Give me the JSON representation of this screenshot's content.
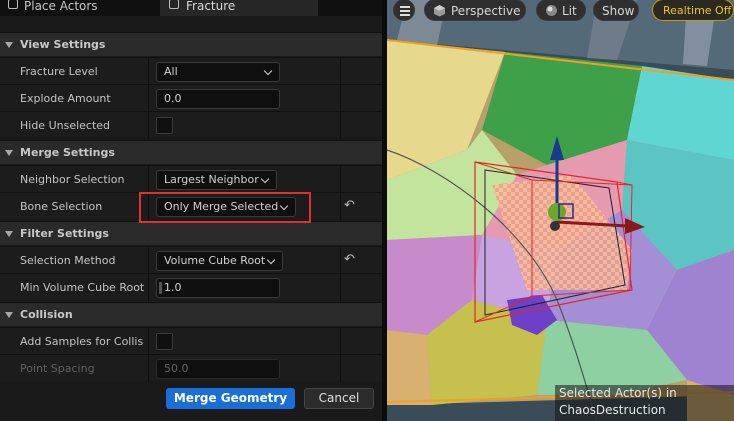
{
  "tabs": [
    {
      "label": "Place Actors",
      "icon": "place-actors-icon"
    },
    {
      "label": "Fracture",
      "icon": "fracture-icon",
      "active": true,
      "close": "×"
    }
  ],
  "sections": {
    "view_settings": {
      "title": "View Settings",
      "fracture_level": {
        "label": "Fracture Level",
        "value": "All"
      },
      "explode_amount": {
        "label": "Explode Amount",
        "value": "0.0"
      },
      "hide_unselected": {
        "label": "Hide Unselected",
        "checked": false
      }
    },
    "merge_settings": {
      "title": "Merge Settings",
      "neighbor_selection": {
        "label": "Neighbor Selection",
        "value": "Largest Neighbor"
      },
      "bone_selection": {
        "label": "Bone Selection",
        "value": "Only Merge Selected"
      }
    },
    "filter_settings": {
      "title": "Filter Settings",
      "selection_method": {
        "label": "Selection Method",
        "value": "Volume Cube Root"
      },
      "min_volume": {
        "label": "Min Volume Cube Root",
        "value": "1.0"
      }
    },
    "collision": {
      "title": "Collision",
      "add_samples": {
        "label": "Add Samples for Collis...",
        "checked": false
      },
      "point_spacing": {
        "label": "Point Spacing",
        "value": "50.0"
      }
    }
  },
  "footer": {
    "merge_label": "Merge Geometry",
    "cancel_label": "Cancel"
  },
  "viewport": {
    "perspective_label": "Perspective",
    "lit_label": "Lit",
    "show_label": "Show",
    "realtime_label": "Realtime Off",
    "status_line1": "Selected Actor(s) in",
    "status_line2": "ChaosDestruction (Persistent)"
  },
  "colors": {
    "accent_blue": "#1a6ed8",
    "highlight_red": "#e03030",
    "realtime_yellow": "#f3c423",
    "panel_bg": "#1a1a1a",
    "section_bg": "#2a2a2a"
  }
}
